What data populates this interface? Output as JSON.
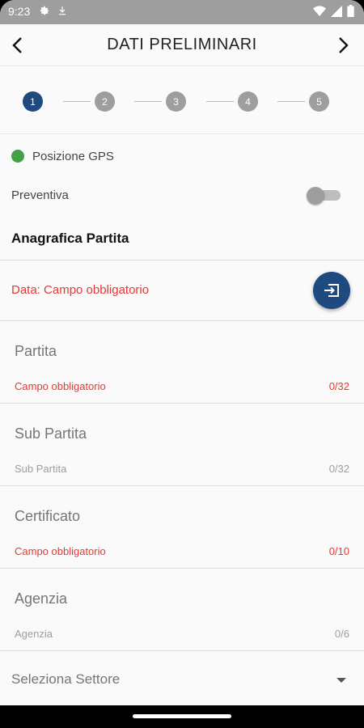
{
  "status_bar": {
    "time": "9:23",
    "icons": [
      "settings-icon",
      "download-icon",
      "wifi-icon",
      "signal-icon",
      "battery-icon"
    ]
  },
  "app_bar": {
    "title": "DATI PRELIMINARI",
    "back_icon": "chevron-left-icon",
    "next_icon": "chevron-right-icon"
  },
  "stepper": {
    "steps": [
      "1",
      "2",
      "3",
      "4",
      "5"
    ],
    "active_step": 1,
    "active_color": "#1f4a80",
    "inactive_color": "#9e9e9e"
  },
  "gps": {
    "label": "Posizione GPS",
    "status_color": "#43a047"
  },
  "preventiva": {
    "label": "Preventiva",
    "checked": false
  },
  "section": {
    "title": "Anagrafica Partita"
  },
  "date": {
    "error": "Data: Campo obbligatorio",
    "button_icon": "login-enter-icon"
  },
  "fields": {
    "partita": {
      "placeholder": "Partita",
      "helper": "Campo obbligatorio",
      "counter": "0/32",
      "error": true
    },
    "sub_partita": {
      "placeholder": "Sub Partita",
      "helper": "Sub Partita",
      "counter": "0/32",
      "error": false
    },
    "certificato": {
      "placeholder": "Certificato",
      "helper": "Campo obbligatorio",
      "counter": "0/10",
      "error": true
    },
    "agenzia": {
      "placeholder": "Agenzia",
      "helper": "Agenzia",
      "counter": "0/6",
      "error": false
    }
  },
  "settore": {
    "label": "Seleziona Settore",
    "icon": "dropdown-caret-icon"
  },
  "colors": {
    "error": "#e53935",
    "primary": "#1f4a80"
  }
}
